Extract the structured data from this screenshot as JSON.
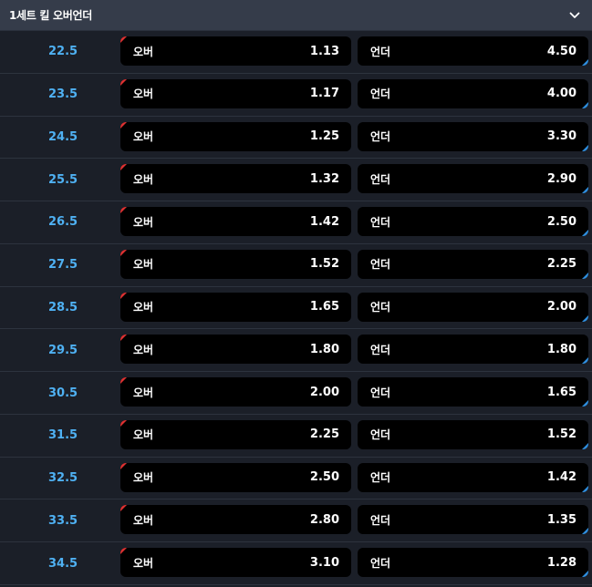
{
  "market": {
    "title": "1세트 킬 오버언더",
    "toggle_icon": "chevron-down-icon"
  },
  "colors": {
    "header_bg": "#353c4a",
    "row_bg": "#1b1f28",
    "line_value": "#4fb1f3",
    "odd_box": "#000000",
    "over_accent": "#e03131",
    "under_accent": "#2f8fe0"
  },
  "rows": [
    {
      "line": "22.5",
      "over_label": "오버",
      "over_odds": "1.13",
      "under_label": "언더",
      "under_odds": "4.50"
    },
    {
      "line": "23.5",
      "over_label": "오버",
      "over_odds": "1.17",
      "under_label": "언더",
      "under_odds": "4.00"
    },
    {
      "line": "24.5",
      "over_label": "오버",
      "over_odds": "1.25",
      "under_label": "언더",
      "under_odds": "3.30"
    },
    {
      "line": "25.5",
      "over_label": "오버",
      "over_odds": "1.32",
      "under_label": "언더",
      "under_odds": "2.90"
    },
    {
      "line": "26.5",
      "over_label": "오버",
      "over_odds": "1.42",
      "under_label": "언더",
      "under_odds": "2.50"
    },
    {
      "line": "27.5",
      "over_label": "오버",
      "over_odds": "1.52",
      "under_label": "언더",
      "under_odds": "2.25"
    },
    {
      "line": "28.5",
      "over_label": "오버",
      "over_odds": "1.65",
      "under_label": "언더",
      "under_odds": "2.00"
    },
    {
      "line": "29.5",
      "over_label": "오버",
      "over_odds": "1.80",
      "under_label": "언더",
      "under_odds": "1.80"
    },
    {
      "line": "30.5",
      "over_label": "오버",
      "over_odds": "2.00",
      "under_label": "언더",
      "under_odds": "1.65"
    },
    {
      "line": "31.5",
      "over_label": "오버",
      "over_odds": "2.25",
      "under_label": "언더",
      "under_odds": "1.52"
    },
    {
      "line": "32.5",
      "over_label": "오버",
      "over_odds": "2.50",
      "under_label": "언더",
      "under_odds": "1.42"
    },
    {
      "line": "33.5",
      "over_label": "오버",
      "over_odds": "2.80",
      "under_label": "언더",
      "under_odds": "1.35"
    },
    {
      "line": "34.5",
      "over_label": "오버",
      "over_odds": "3.10",
      "under_label": "언더",
      "under_odds": "1.28"
    }
  ]
}
